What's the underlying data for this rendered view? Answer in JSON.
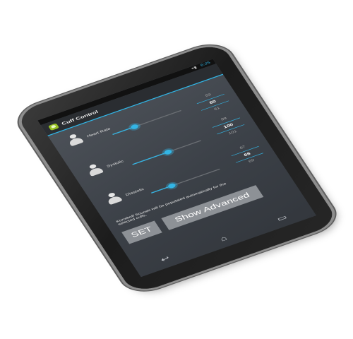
{
  "status_bar": {
    "time": "6:25"
  },
  "app": {
    "title": "Cuff Control"
  },
  "sliders": [
    {
      "label": "Heart Rate",
      "level": 0.32,
      "values": [
        "",
        "59",
        "60",
        "61"
      ],
      "current_index": 2
    },
    {
      "label": "Systolic",
      "level": 0.52,
      "values": [
        "99",
        "100",
        "101",
        ""
      ],
      "current_index": 1
    },
    {
      "label": "Diastolic",
      "level": 0.3,
      "values": [
        "67",
        "68",
        "69",
        ""
      ],
      "current_index": 1
    }
  ],
  "note": "Korotkoff Sounds will be populated automatically for the selected cuffs.",
  "buttons": {
    "set": "SET",
    "show_advanced": "Show Advanced"
  },
  "navigation": {
    "back": "↩",
    "home": "⌂",
    "recents": "▭"
  },
  "colors": {
    "accent": "#33b5e5",
    "screen": "#3c4148",
    "button": "#8d9196"
  }
}
